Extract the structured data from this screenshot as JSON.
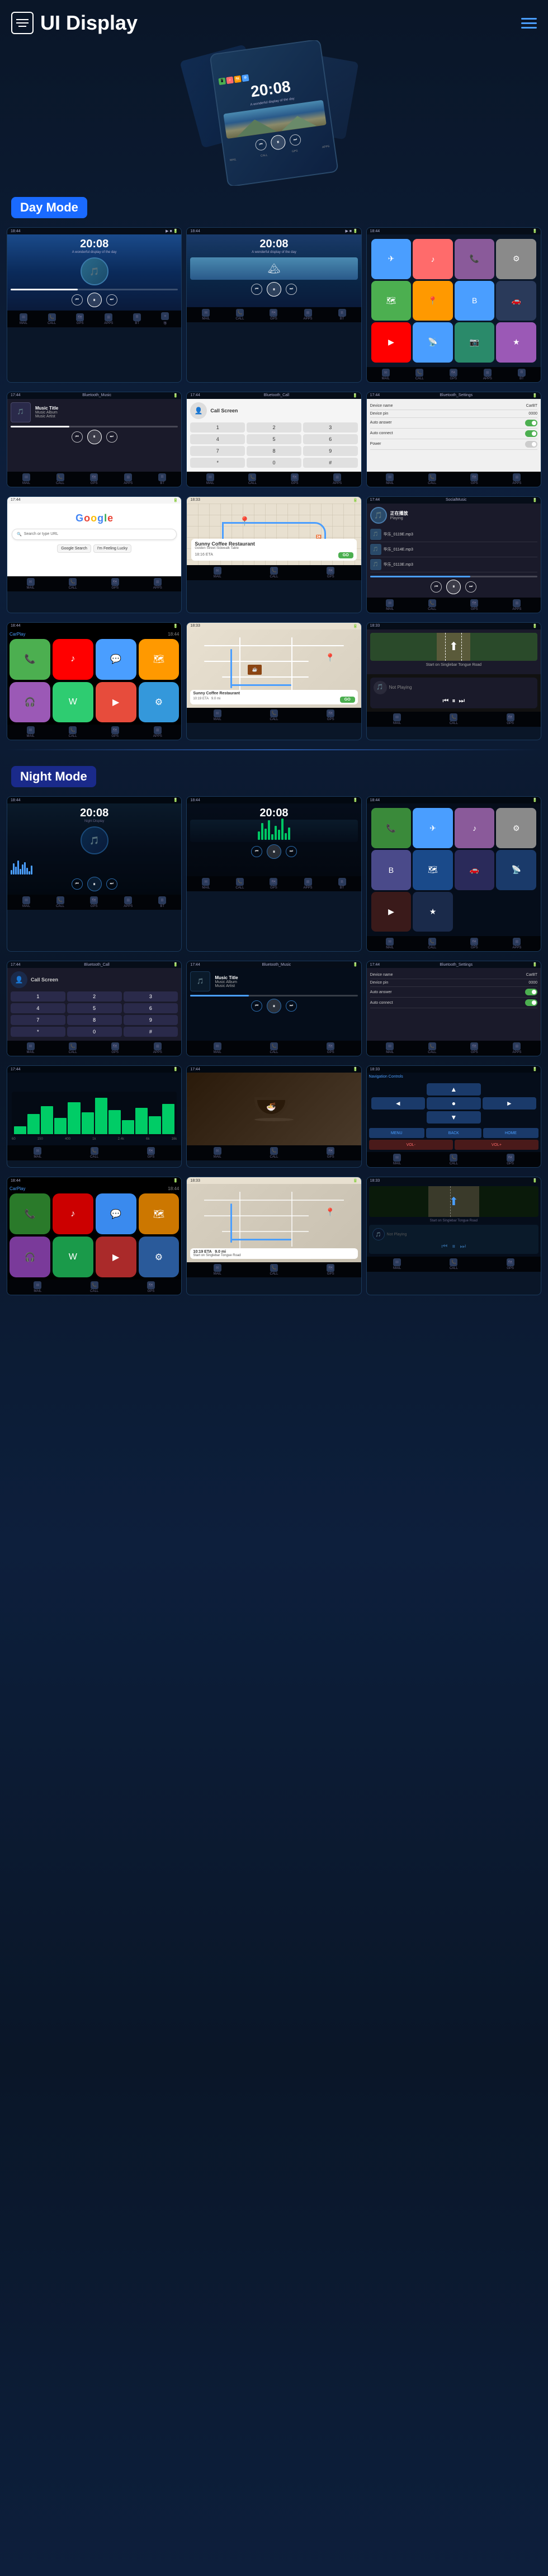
{
  "app": {
    "title": "UI Display",
    "menu_icon": "☰",
    "nav_icon": "≡"
  },
  "sections": {
    "day_mode": "Day Mode",
    "night_mode": "Night Mode"
  },
  "hero": {
    "time": "20:08",
    "date": "A wonderful display of the day"
  },
  "day_screens": {
    "home1": {
      "time": "20:08",
      "date": "A wonderful display of the day"
    },
    "home2": {
      "time": "20:08",
      "date": "A wonderful display of the day"
    },
    "music": {
      "title": "Music Title",
      "album": "Music Album",
      "artist": "Music Artist",
      "screen_label": "Bluetooth_Music"
    },
    "phone": {
      "screen_label": "Bluetooth_Call"
    },
    "settings": {
      "screen_label": "Bluetooth_Settings",
      "device_name": {
        "label": "Device name",
        "value": "CarBT"
      },
      "device_pin": {
        "label": "Device pin",
        "value": "0000"
      },
      "auto_answer": {
        "label": "Auto answer"
      },
      "auto_connect": {
        "label": "Auto connect"
      },
      "power": {
        "label": "Power"
      }
    },
    "google": {
      "logo": "Google",
      "search_placeholder": "Search or type URL"
    },
    "maps": {
      "restaurant": "Sunny Coffee Restaurant",
      "address": "Golden Street\nSidewalk Table",
      "eta": "18:16 ETA",
      "distance": "9.0 mi",
      "go": "GO"
    },
    "social_music": {
      "screen_label": "SocialMusic",
      "songs": [
        "华乐_0119E.mp3",
        "华乐_0114E.mp3",
        "华乐_0113E.mp3"
      ]
    },
    "navigation": {
      "start": "Start on Singlebar Tongue Road"
    },
    "not_playing": "Not Playing"
  },
  "night_screens": {
    "home1": {
      "time": "20:08"
    },
    "home2": {
      "time": "20:08"
    },
    "phone": {
      "screen_label": "Bluetooth_Call"
    },
    "music": {
      "screen_label": "Bluetooth_Music",
      "title": "Music Title",
      "album": "Music Album",
      "artist": "Music Artist"
    },
    "settings": {
      "screen_label": "Bluetooth_Settings",
      "device_name": {
        "label": "Device name",
        "value": "CarBT"
      },
      "device_pin": {
        "label": "Device pin",
        "value": "0000"
      },
      "auto_answer": {
        "label": "Auto answer"
      },
      "auto_connect": {
        "label": "Auto connect"
      }
    }
  },
  "bottom_bar": {
    "items": [
      "MAIL",
      "CALL",
      "GPS",
      "APPS",
      "BT",
      "等"
    ]
  },
  "apps": {
    "colors": {
      "phone": "#4CAF50",
      "messages": "#4CAF50",
      "music": "#ff6b6b",
      "maps": "#4a9eff",
      "settings": "#8a8a8a",
      "bt": "#4a9eff",
      "telegram": "#4a9eff",
      "youtube": "#ff0000",
      "waze": "#6ad4ff",
      "carplay": "#1a1a2a",
      "camera": "#9b59b6"
    }
  }
}
